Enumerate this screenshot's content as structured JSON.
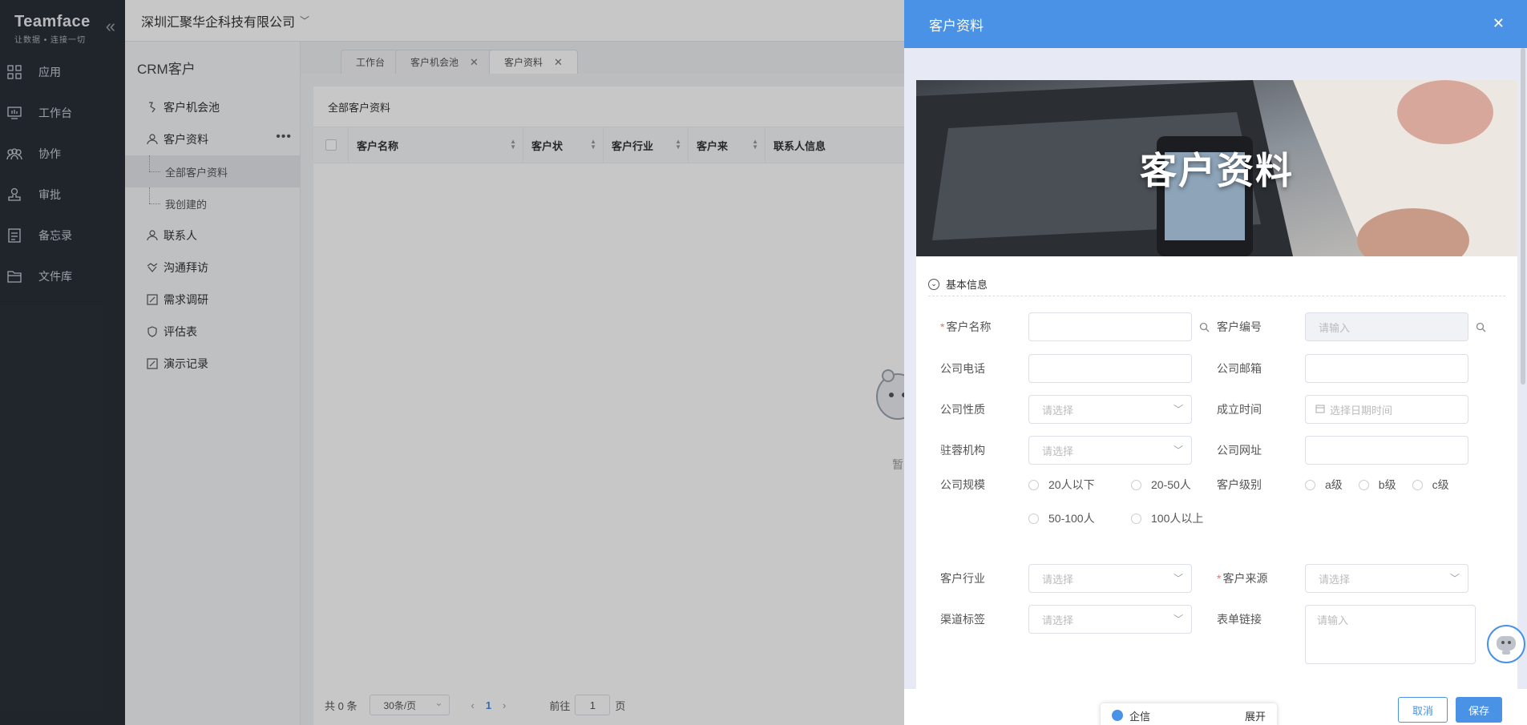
{
  "brand": {
    "name": "Teamface",
    "slogan": "让数据 • 连接一切"
  },
  "company": "深圳汇聚华企科技有限公司",
  "leftnav": [
    {
      "label": "应用",
      "icon": "grid-icon"
    },
    {
      "label": "工作台",
      "icon": "monitor-icon"
    },
    {
      "label": "协作",
      "icon": "people-icon"
    },
    {
      "label": "审批",
      "icon": "stamp-icon"
    },
    {
      "label": "备忘录",
      "icon": "note-icon"
    },
    {
      "label": "文件库",
      "icon": "folder-icon"
    }
  ],
  "secnav": {
    "title": "CRM客户",
    "items": [
      {
        "label": "客户机会池"
      },
      {
        "label": "客户资料"
      },
      {
        "label": "全部客户资料"
      },
      {
        "label": "我创建的"
      },
      {
        "label": "联系人"
      },
      {
        "label": "沟通拜访"
      },
      {
        "label": "需求调研"
      },
      {
        "label": "评估表"
      },
      {
        "label": "演示记录"
      }
    ]
  },
  "tabs": [
    {
      "label": "工作台"
    },
    {
      "label": "客户机会池"
    },
    {
      "label": "客户资料"
    }
  ],
  "list": {
    "title": "全部客户资料",
    "columns": [
      "客户名称",
      "客户状",
      "客户行业",
      "客户来",
      "联系人信息"
    ],
    "empty_text": "暂",
    "pager": {
      "total": "共 0 条",
      "page_size": "30条/页",
      "current": "1",
      "goto": "前往",
      "goto_value": "1",
      "page_unit": "页"
    }
  },
  "drawer": {
    "title": "客户资料",
    "banner_text": "客户资料",
    "section": "基本信息",
    "fields": {
      "customer_name": {
        "label": "客户名称",
        "required": "*"
      },
      "customer_no": {
        "label": "客户编号",
        "placeholder": "请输入"
      },
      "company_phone": {
        "label": "公司电话"
      },
      "company_email": {
        "label": "公司邮箱"
      },
      "company_nature": {
        "label": "公司性质",
        "placeholder": "请选择"
      },
      "founded": {
        "label": "成立时间",
        "placeholder": "选择日期时间"
      },
      "office": {
        "label": "驻蓉机构",
        "placeholder": "请选择"
      },
      "website": {
        "label": "公司网址"
      },
      "scale": {
        "label": "公司规模",
        "options": [
          "20人以下",
          "20-50人",
          "50-100人",
          "100人以上"
        ]
      },
      "level": {
        "label": "客户级别",
        "options": [
          "a级",
          "b级",
          "c级"
        ]
      },
      "industry": {
        "label": "客户行业",
        "placeholder": "请选择"
      },
      "source": {
        "label": "客户来源",
        "required": "*",
        "placeholder": "请选择"
      },
      "channel": {
        "label": "渠道标签",
        "placeholder": "请选择"
      },
      "form_link": {
        "label": "表单链接",
        "placeholder": "请输入"
      }
    },
    "cancel": "取消",
    "save": "保存"
  },
  "chat": {
    "label": "企信",
    "expand": "展开"
  }
}
